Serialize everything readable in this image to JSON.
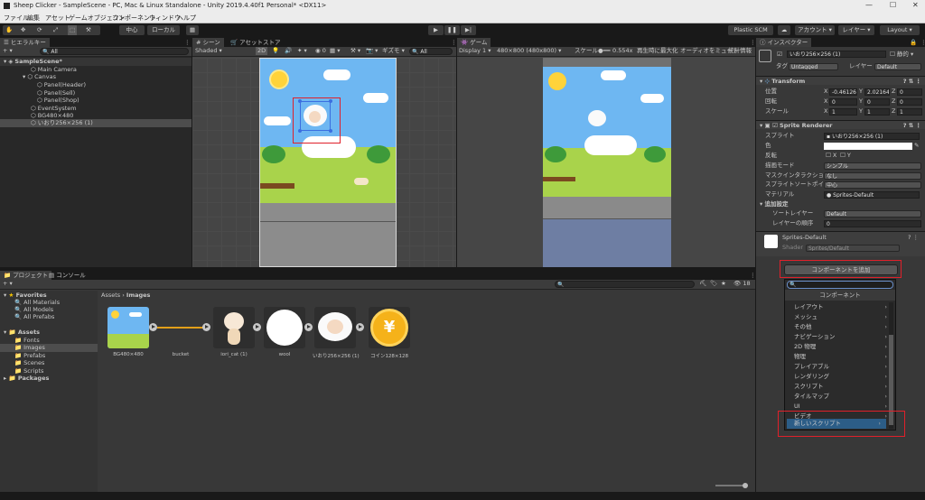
{
  "titlebar": {
    "title": "Sheep Clicker - SampleScene - PC, Mac & Linux Standalone - Unity 2019.4.40f1 Personal* <DX11>",
    "minimize": "—",
    "maximize": "☐",
    "close": "✕"
  },
  "menu": [
    "ファイル",
    "編集",
    "アセット",
    "ゲームオブジェクト",
    "コンポーネント",
    "ウィンドウ",
    "ヘルプ"
  ],
  "toolbar": {
    "pivot": "中心",
    "space": "ローカル",
    "plastic": "Plastic SCM",
    "account": "アカウント",
    "layers": "レイヤー",
    "layout": "Layout"
  },
  "hierarchy": {
    "tab": "ヒエラルキー",
    "search_placeholder": "All",
    "scene": "SampleScene*",
    "items": [
      "Main Camera",
      "Canvas",
      "Panel(Header)",
      "Panel(Sell)",
      "Panel(Shop)",
      "EventSystem",
      "BG480×480",
      "いおり256×256 (1)"
    ]
  },
  "scene": {
    "tab_scene": "シーン",
    "tab_store": "アセットストア",
    "shading": "Shaded",
    "mode2d": "2D",
    "gizmos": "ギズモ",
    "search": "All"
  },
  "game": {
    "tab": "ゲーム",
    "display": "Display 1",
    "resolution": "480×800 (480x800)",
    "scale_label": "スケール",
    "scale_value": "0.554x",
    "maximize": "再生時に最大化",
    "mute": "オーディオをミュート",
    "stats": "統計情報"
  },
  "inspector": {
    "tab": "インスペクター",
    "object_name": "いおり256×256 (1)",
    "static": "静的",
    "tag_label": "タグ",
    "tag": "Untagged",
    "layer_label": "レイヤー",
    "layer": "Default",
    "transform": {
      "title": "Transform",
      "position": "位置",
      "rotation": "回転",
      "scale": "スケール",
      "px": "-0.46126",
      "py": "2.02164",
      "pz": "0",
      "rx": "0",
      "ry": "0",
      "rz": "0",
      "sx": "1",
      "sy": "1",
      "sz": "1"
    },
    "sprite_renderer": {
      "title": "Sprite Renderer",
      "sprite_label": "スプライト",
      "sprite": "いおり256×256 (1)",
      "color_label": "色",
      "flip_label": "反転",
      "flip_x": "X",
      "flip_y": "Y",
      "draw_mode_label": "描画モード",
      "draw_mode": "シンプル",
      "mask_label": "マスクインタラクション",
      "mask": "なし",
      "sort_point_label": "スプライトソートポイント",
      "sort_point": "中心",
      "material_label": "マテリアル",
      "material": "Sprites-Default",
      "additional": "追加設定",
      "sorting_layer_label": "ソートレイヤー",
      "sorting_layer": "Default",
      "order_label": "レイヤーの順序",
      "order": "0"
    },
    "material": {
      "name": "Sprites-Default",
      "shader_label": "Shader",
      "shader": "Sprites/Default"
    },
    "add_component": "コンポーネントを追加",
    "component_menu": {
      "title": "コンポーネント",
      "items": [
        "レイアウト",
        "メッシュ",
        "その他",
        "ナビゲーション",
        "2D 物理",
        "物理",
        "プレイアブル",
        "レンダリング",
        "スクリプト",
        "タイルマップ",
        "UI",
        "ビデオ",
        "新しいスクリプト"
      ],
      "highlight_index": 12
    },
    "lock": "🔒"
  },
  "project": {
    "tab_project": "プロジェクト",
    "tab_console": "コンソール",
    "count": "18",
    "favorites": "Favorites",
    "fav_items": [
      "All Materials",
      "All Models",
      "All Prefabs"
    ],
    "assets": "Assets",
    "asset_folders": [
      "Fonts",
      "Images",
      "Prefabs",
      "Scenes",
      "Scripts"
    ],
    "packages": "Packages",
    "breadcrumb_root": "Assets",
    "breadcrumb_sep": "›",
    "breadcrumb_current": "Images",
    "files": [
      "BG480×480",
      "bucket",
      "iori_cat (1)",
      "wool",
      "いおり256×256 (1)",
      "コイン128×128"
    ]
  },
  "colors": {
    "accent": "#2c5d87",
    "red": "#e0202a",
    "sky": "#6eb7f2",
    "grass": "#a9d34b",
    "coin": "#f5b21a"
  }
}
